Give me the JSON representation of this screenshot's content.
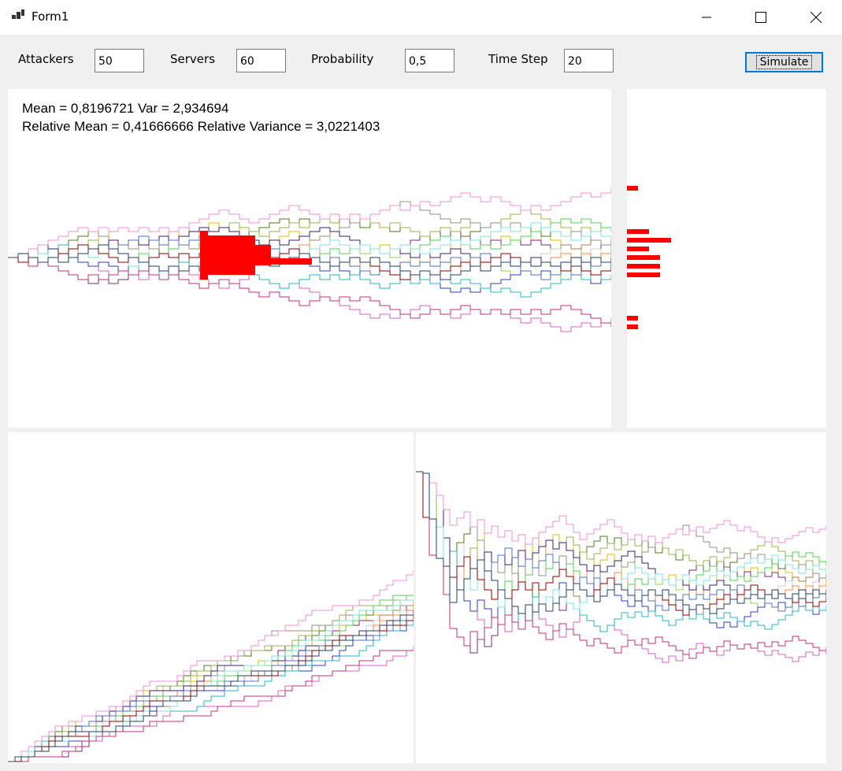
{
  "window": {
    "title": "Form1"
  },
  "controls": {
    "attackers_label": "Attackers",
    "attackers_value": "50",
    "servers_label": "Servers",
    "servers_value": "60",
    "probability_label": "Probability",
    "probability_value": "0,5",
    "time_step_label": "Time Step",
    "time_step_value": "20",
    "simulate_label": "Simulate"
  },
  "stats": {
    "line1": "Mean = 0,8196721 Var = 2,934694",
    "line2": "Relative Mean = 0,41666666 Relative Variance = 3,0221403"
  },
  "colors": {
    "histogram": "#ff0000",
    "accent": "#0078d7",
    "series": [
      "#e6c200",
      "#7c2a7a",
      "#8fd65a",
      "#a47f50",
      "#ccc",
      "#4f7a1f",
      "#d960c8",
      "#2c3cbf",
      "#28b5c8",
      "#ff8b3d",
      "#9ab34d",
      "#9a8f7d",
      "#50d050",
      "#c03078",
      "#3a2070",
      "#f090d8",
      "#80e0e0",
      "#5070c0",
      "#8b0000",
      "#204060"
    ]
  }
}
